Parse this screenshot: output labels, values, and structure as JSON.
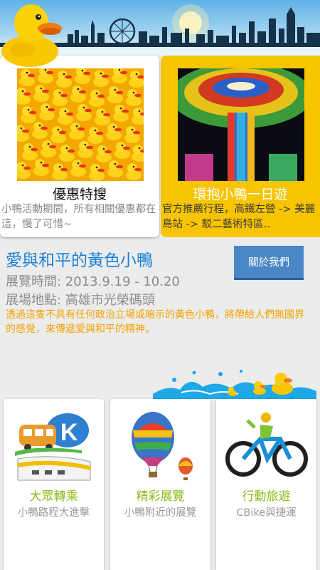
{
  "cards": [
    {
      "title": "優惠特搜",
      "desc": "小鴨活動期間，所有相關優惠都在這，慢了可惜~"
    },
    {
      "title": "環抱小鴨一日遊",
      "desc": "官方推薦行程，高鐵左營 -> 美麗島站 -> 駁二藝術特區.."
    }
  ],
  "info": {
    "title": "愛與和平的黃色小鴨",
    "about_button": "關於我們",
    "time": "展覽時間: 2013.9.19 - 10.20",
    "venue": "展場地點: 高雄市光榮碼頭",
    "desc": "透過這隻不具有任何政治立場或暗示的黃色小鴨，將帶給人們無國界的感覺，來傳遞愛與和平的精神。"
  },
  "tiles": [
    {
      "title": "大眾轉乘",
      "subtitle": "小鴨路程大進擊",
      "icon": "bus-train-icon"
    },
    {
      "title": "精彩展覽",
      "subtitle": "小鴨附近的展覽",
      "icon": "hot-air-balloon-icon"
    },
    {
      "title": "行動旅遊",
      "subtitle": "CBike與捷運",
      "icon": "bicycle-icon"
    }
  ],
  "colors": {
    "title_blue": "#1b82d6",
    "card_yellow": "#f7c400",
    "tile_green": "#8dba1a",
    "desc_orange": "#f2a300",
    "button_blue": "#4b86c6"
  }
}
